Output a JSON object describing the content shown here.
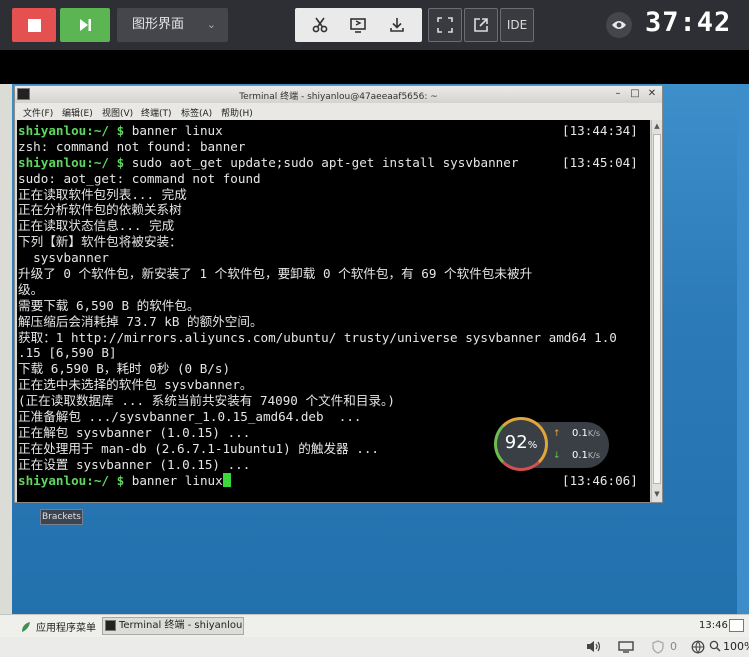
{
  "topbar": {
    "mode_label": "图形界面",
    "ide_label": "IDE",
    "timer": "37:42",
    "icons": [
      "stop-icon",
      "step-forward-icon",
      "chevron-down-icon",
      "scissors-icon",
      "screen-share-icon",
      "download-icon",
      "fullscreen-icon",
      "external-link-icon",
      "eye-icon"
    ]
  },
  "window": {
    "title": "Terminal 终端 - shiyanlou@47aeeaaf5656: ~",
    "menu": [
      "文件(F)",
      "编辑(E)",
      "视图(V)",
      "终端(T)",
      "标签(A)",
      "帮助(H)"
    ]
  },
  "terminal": {
    "prompt": "shiyanlou:~/ $ ",
    "lines": [
      {
        "prompt": true,
        "cmd": "banner linux",
        "ts": "[13:44:34]"
      },
      {
        "text": "zsh: command not found: banner"
      },
      {
        "prompt": true,
        "cmd": "sudo aot_get update;sudo apt-get install sysvbanner",
        "ts": "[13:45:04]"
      },
      {
        "text": "sudo: aot_get: command not found"
      },
      {
        "text": "正在读取软件包列表... 完成"
      },
      {
        "text": "正在分析软件包的依赖关系树"
      },
      {
        "text": "正在读取状态信息... 完成"
      },
      {
        "text": "下列【新】软件包将被安装："
      },
      {
        "text": "  sysvbanner"
      },
      {
        "text": "升级了 0 个软件包，新安装了 1 个软件包，要卸载 0 个软件包，有 69 个软件包未被升"
      },
      {
        "text": "级。"
      },
      {
        "text": "需要下载 6,590 B 的软件包。"
      },
      {
        "text": "解压缩后会消耗掉 73.7 kB 的额外空间。"
      },
      {
        "text": "获取：1 http://mirrors.aliyuncs.com/ubuntu/ trusty/universe sysvbanner amd64 1.0"
      },
      {
        "text": ".15 [6,590 B]"
      },
      {
        "text": "下载 6,590 B，耗时 0秒 (0 B/s)"
      },
      {
        "text": "正在选中未选择的软件包 sysvbanner。"
      },
      {
        "text": "(正在读取数据库 ... 系统当前共安装有 74090 个文件和目录。)"
      },
      {
        "text": "正准备解包 .../sysvbanner_1.0.15_amd64.deb  ..."
      },
      {
        "text": "正在解包 sysvbanner (1.0.15) ..."
      },
      {
        "text": "正在处理用于 man-db (2.6.7.1-1ubuntu1) 的触发器 ..."
      },
      {
        "text": "正在设置 sysvbanner (1.0.15) ..."
      },
      {
        "prompt": true,
        "cmd": "banner linux",
        "ts": "[13:46:06]",
        "cursor": true
      }
    ]
  },
  "network_widget": {
    "percent": "92",
    "percent_unit": "%",
    "upload": "0.1",
    "download": "0.1",
    "unit": "K/s"
  },
  "desktop": {
    "brackets_label": "Brackets"
  },
  "taskbar": {
    "start_label": "应用程序菜单",
    "task_label": "Terminal 终端 - shiyanlou@...",
    "clock": "13:46"
  },
  "statusbar": {
    "badge_count": "0",
    "zoom": "100%"
  },
  "colors": {
    "prompt": "#5fd75f",
    "stop_button": "#e55151",
    "next_button": "#5ab552"
  }
}
